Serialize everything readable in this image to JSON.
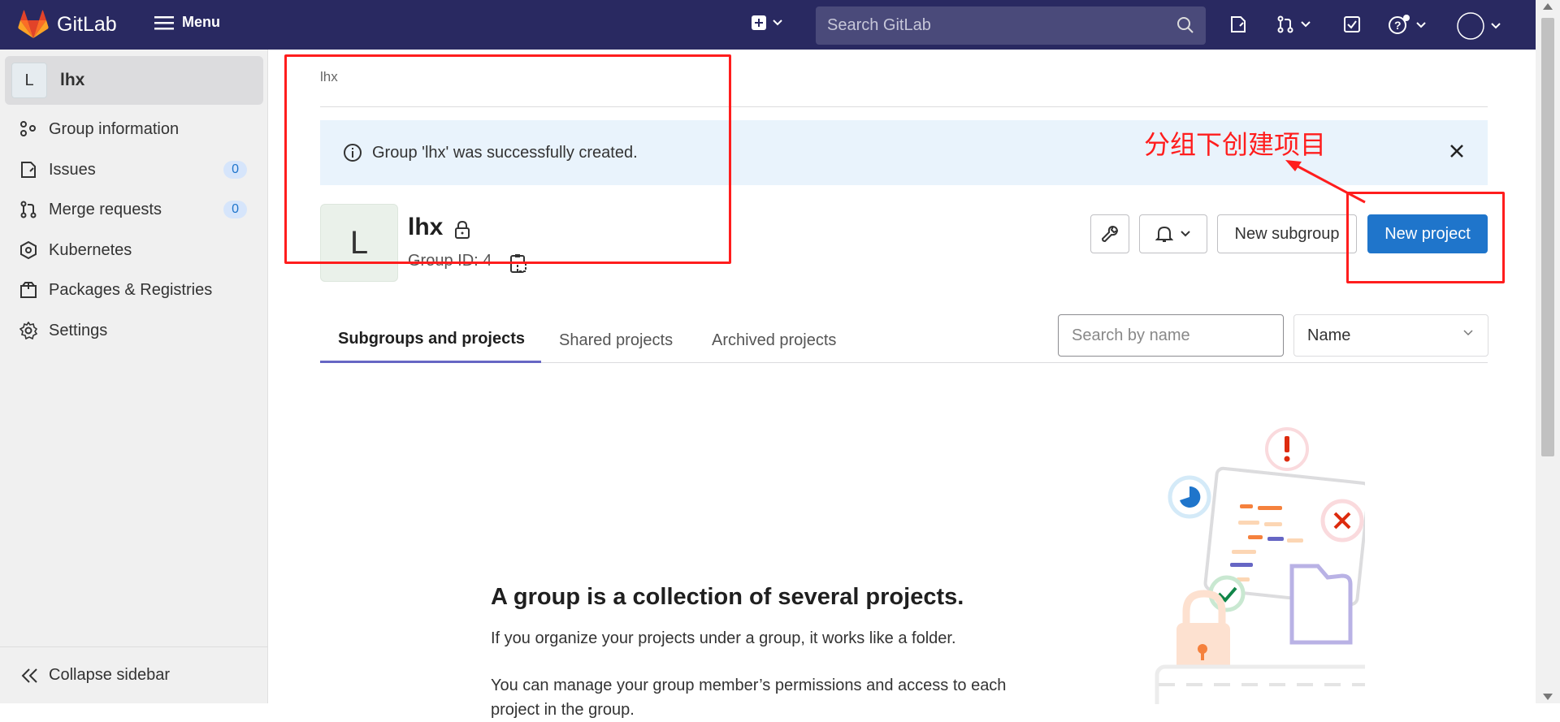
{
  "navbar": {
    "brand": "GitLab",
    "menu_label": "Menu",
    "search_placeholder": "Search GitLab"
  },
  "sidebar": {
    "group_avatar": "L",
    "group_name": "lhx",
    "items": [
      {
        "label": "Group information",
        "icon": "group-info-icon"
      },
      {
        "label": "Issues",
        "icon": "issues-icon",
        "count": "0"
      },
      {
        "label": "Merge requests",
        "icon": "merge-request-icon",
        "count": "0"
      },
      {
        "label": "Kubernetes",
        "icon": "kubernetes-icon"
      },
      {
        "label": "Packages & Registries",
        "icon": "package-icon"
      },
      {
        "label": "Settings",
        "icon": "settings-icon"
      }
    ],
    "collapse_label": "Collapse sidebar"
  },
  "main": {
    "breadcrumb": "lhx",
    "alert": "Group 'lhx' was successfully created.",
    "group": {
      "avatar": "L",
      "name": "lhx",
      "id_text": "Group ID: 4"
    },
    "buttons": {
      "new_subgroup": "New subgroup",
      "new_project": "New project"
    },
    "tabs": [
      "Subgroups and projects",
      "Shared projects",
      "Archived projects"
    ],
    "search_placeholder": "Search by name",
    "sort_value": "Name",
    "empty_state": {
      "title": "A group is a collection of several projects.",
      "p1": "If you organize your projects under a group, it works like a folder.",
      "p2": "You can manage your group member’s permissions and access to each project in the group."
    }
  },
  "annotation": {
    "text": "分组下创建项目",
    "color": "#ff1d1d"
  },
  "colors": {
    "navbar": "#292961",
    "primary": "#1f75cb",
    "alert_bg": "#e9f3fc",
    "tab_active": "#6666c4"
  }
}
